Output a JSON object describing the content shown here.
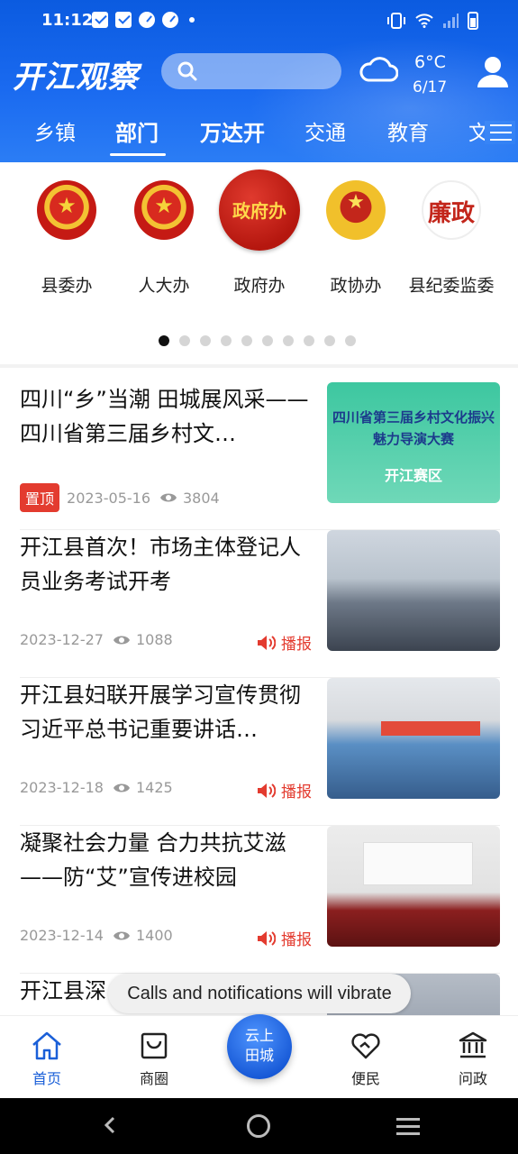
{
  "status_bar": {
    "time": "11:12"
  },
  "header": {
    "logo": "开江观察",
    "search_placeholder": "",
    "weather": {
      "icon": "cloud-icon",
      "temperature": "6°C",
      "date": "6/17"
    }
  },
  "tabs": [
    {
      "label": "乡镇",
      "active": false
    },
    {
      "label": "部门",
      "active": true
    },
    {
      "label": "万达开",
      "active": false
    },
    {
      "label": "交通",
      "active": false
    },
    {
      "label": "教育",
      "active": false
    },
    {
      "label": "文",
      "active": false
    }
  ],
  "departments": [
    {
      "label": "县委办",
      "icon": "national-emblem-icon"
    },
    {
      "label": "人大办",
      "icon": "national-emblem-icon"
    },
    {
      "label": "政府办",
      "icon": "government-office-icon",
      "icon_text": "政府办"
    },
    {
      "label": "政协办",
      "icon": "cppcc-emblem-icon"
    },
    {
      "label": "县纪委监委",
      "icon": "lianzheng-icon",
      "icon_text": "廉政"
    }
  ],
  "pager": {
    "pages": 10,
    "current": 1
  },
  "news": [
    {
      "title": "四川“乡”当潮 田城展风采——四川省第三届乡村文…",
      "pinned": true,
      "pinned_label": "置顶",
      "date": "2023-05-16",
      "views": "3804",
      "thumb": {
        "line1": "四川省第三届乡村文化振兴",
        "line2": "魅力导演大赛",
        "line3": "开江赛区"
      }
    },
    {
      "title": "开江县首次！市场主体登记人员业务考试开考",
      "date": "2023-12-27",
      "views": "1088",
      "broadcast": "播报"
    },
    {
      "title": "开江县妇联开展学习宣传贯彻习近平总书记重要讲话…",
      "date": "2023-12-18",
      "views": "1425",
      "broadcast": "播报"
    },
    {
      "title": "凝聚社会力量 合力共抗艾滋——防“艾”宣传进校园",
      "date": "2023-12-14",
      "views": "1400",
      "broadcast": "播报"
    },
    {
      "title": "开江县深"
    }
  ],
  "toast": "Calls and notifications will vibrate",
  "bottom_nav": {
    "items": [
      {
        "label": "首页",
        "icon": "home-icon",
        "active": true
      },
      {
        "label": "商圈",
        "icon": "shopping-bag-icon",
        "active": false
      },
      {
        "label": "便民",
        "icon": "heart-hands-icon",
        "active": false
      },
      {
        "label": "问政",
        "icon": "government-building-icon",
        "active": false
      }
    ],
    "center": {
      "line1": "云上",
      "line2": "田城"
    }
  },
  "colors": {
    "primary": "#1a6af0",
    "accent_red": "#e33b2f",
    "nav_active": "#1a5fd8"
  }
}
